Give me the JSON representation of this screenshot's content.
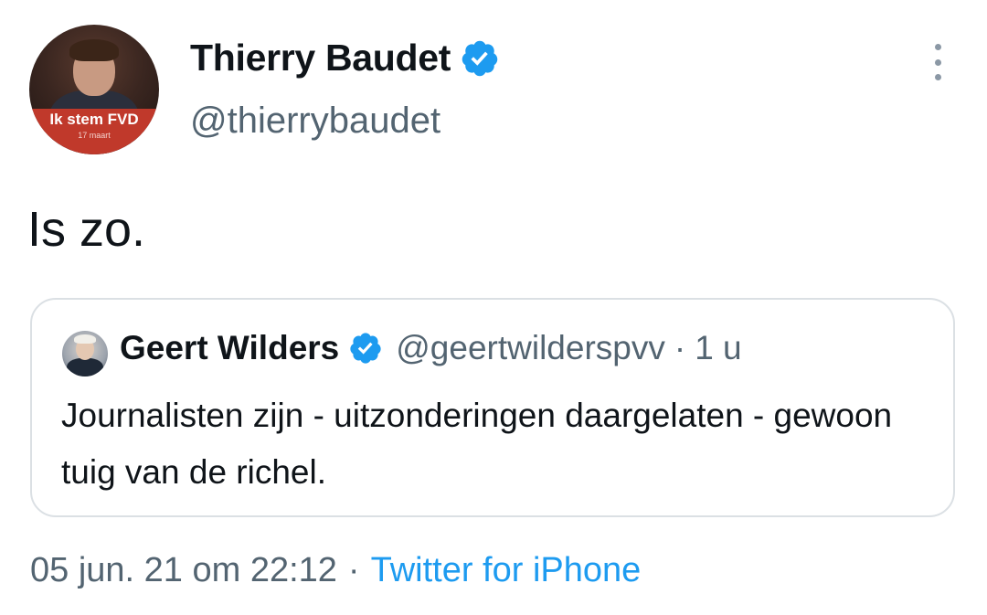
{
  "author": {
    "display_name": "Thierry Baudet",
    "handle": "@thierrybaudet",
    "verified_icon": "verified-badge-icon",
    "avatar_caption": "Ik stem FVD",
    "avatar_subcaption": "17 maart"
  },
  "menu": {
    "icon": "more-vertical-icon"
  },
  "tweet": {
    "text": "Is zo."
  },
  "quoted_tweet": {
    "display_name": "Geert Wilders",
    "handle": "@geertwilderspvv",
    "separator": "·",
    "time": "1 u",
    "text": "Journalisten zijn - uitzonderingen daargelaten - gewoon tuig van de richel.",
    "verified_icon": "verified-badge-icon"
  },
  "meta": {
    "timestamp": "05 jun. 21 om 22:12",
    "separator": "·",
    "source": "Twitter for iPhone"
  },
  "colors": {
    "text_primary": "#0f1419",
    "text_secondary": "#536471",
    "accent": "#1d9bf0",
    "border": "#dbe0e4"
  }
}
